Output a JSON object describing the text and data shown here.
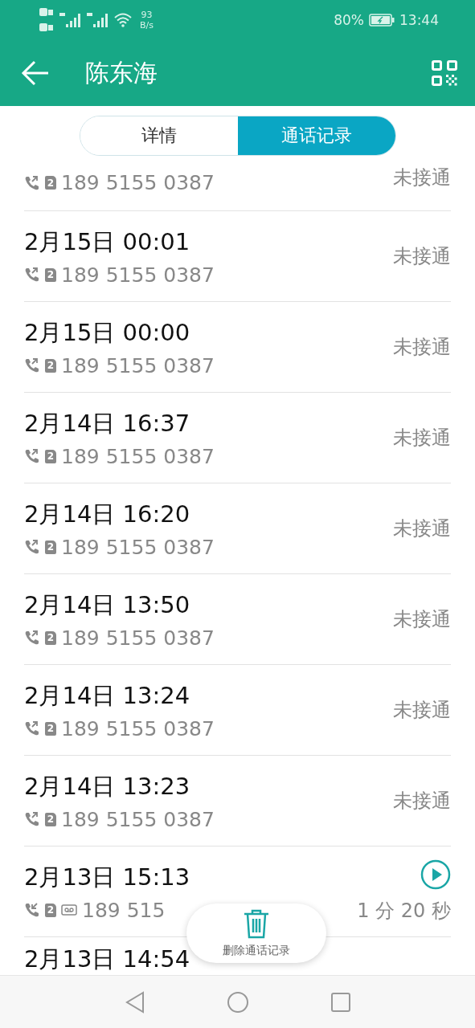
{
  "status_bar": {
    "network_speed": "93",
    "speed_unit": "B/s",
    "battery": "80%",
    "time": "13:44"
  },
  "app_bar": {
    "title": "陈东海"
  },
  "tabs": [
    {
      "label": "详情",
      "selected": false
    },
    {
      "label": "通话记录",
      "selected": true
    }
  ],
  "calls": [
    {
      "kind": "outgoing",
      "sim": "2",
      "voicemail": false,
      "number": "189 5155 0387",
      "status": "未接通"
    },
    {
      "kind": "outgoing",
      "sim": "2",
      "voicemail": false,
      "time": "2月15日 00:01",
      "number": "189 5155 0387",
      "status": "未接通"
    },
    {
      "kind": "outgoing",
      "sim": "2",
      "voicemail": false,
      "time": "2月15日 00:00",
      "number": "189 5155 0387",
      "status": "未接通"
    },
    {
      "kind": "outgoing",
      "sim": "2",
      "voicemail": false,
      "time": "2月14日 16:37",
      "number": "189 5155 0387",
      "status": "未接通"
    },
    {
      "kind": "outgoing",
      "sim": "2",
      "voicemail": false,
      "time": "2月14日 16:20",
      "number": "189 5155 0387",
      "status": "未接通"
    },
    {
      "kind": "outgoing",
      "sim": "2",
      "voicemail": false,
      "time": "2月14日 13:50",
      "number": "189 5155 0387",
      "status": "未接通"
    },
    {
      "kind": "outgoing",
      "sim": "2",
      "voicemail": false,
      "time": "2月14日 13:24",
      "number": "189 5155 0387",
      "status": "未接通"
    },
    {
      "kind": "outgoing",
      "sim": "2",
      "voicemail": false,
      "time": "2月14日 13:23",
      "number": "189 5155 0387",
      "status": "未接通"
    },
    {
      "kind": "incoming",
      "sim": "2",
      "voicemail": true,
      "time": "2月13日 15:13",
      "number": "189 515",
      "status": "1 分 20 秒"
    },
    {
      "voicemail": false,
      "time": "2月13日 14:54"
    }
  ],
  "delete_button": {
    "label": "删除通话记录"
  }
}
